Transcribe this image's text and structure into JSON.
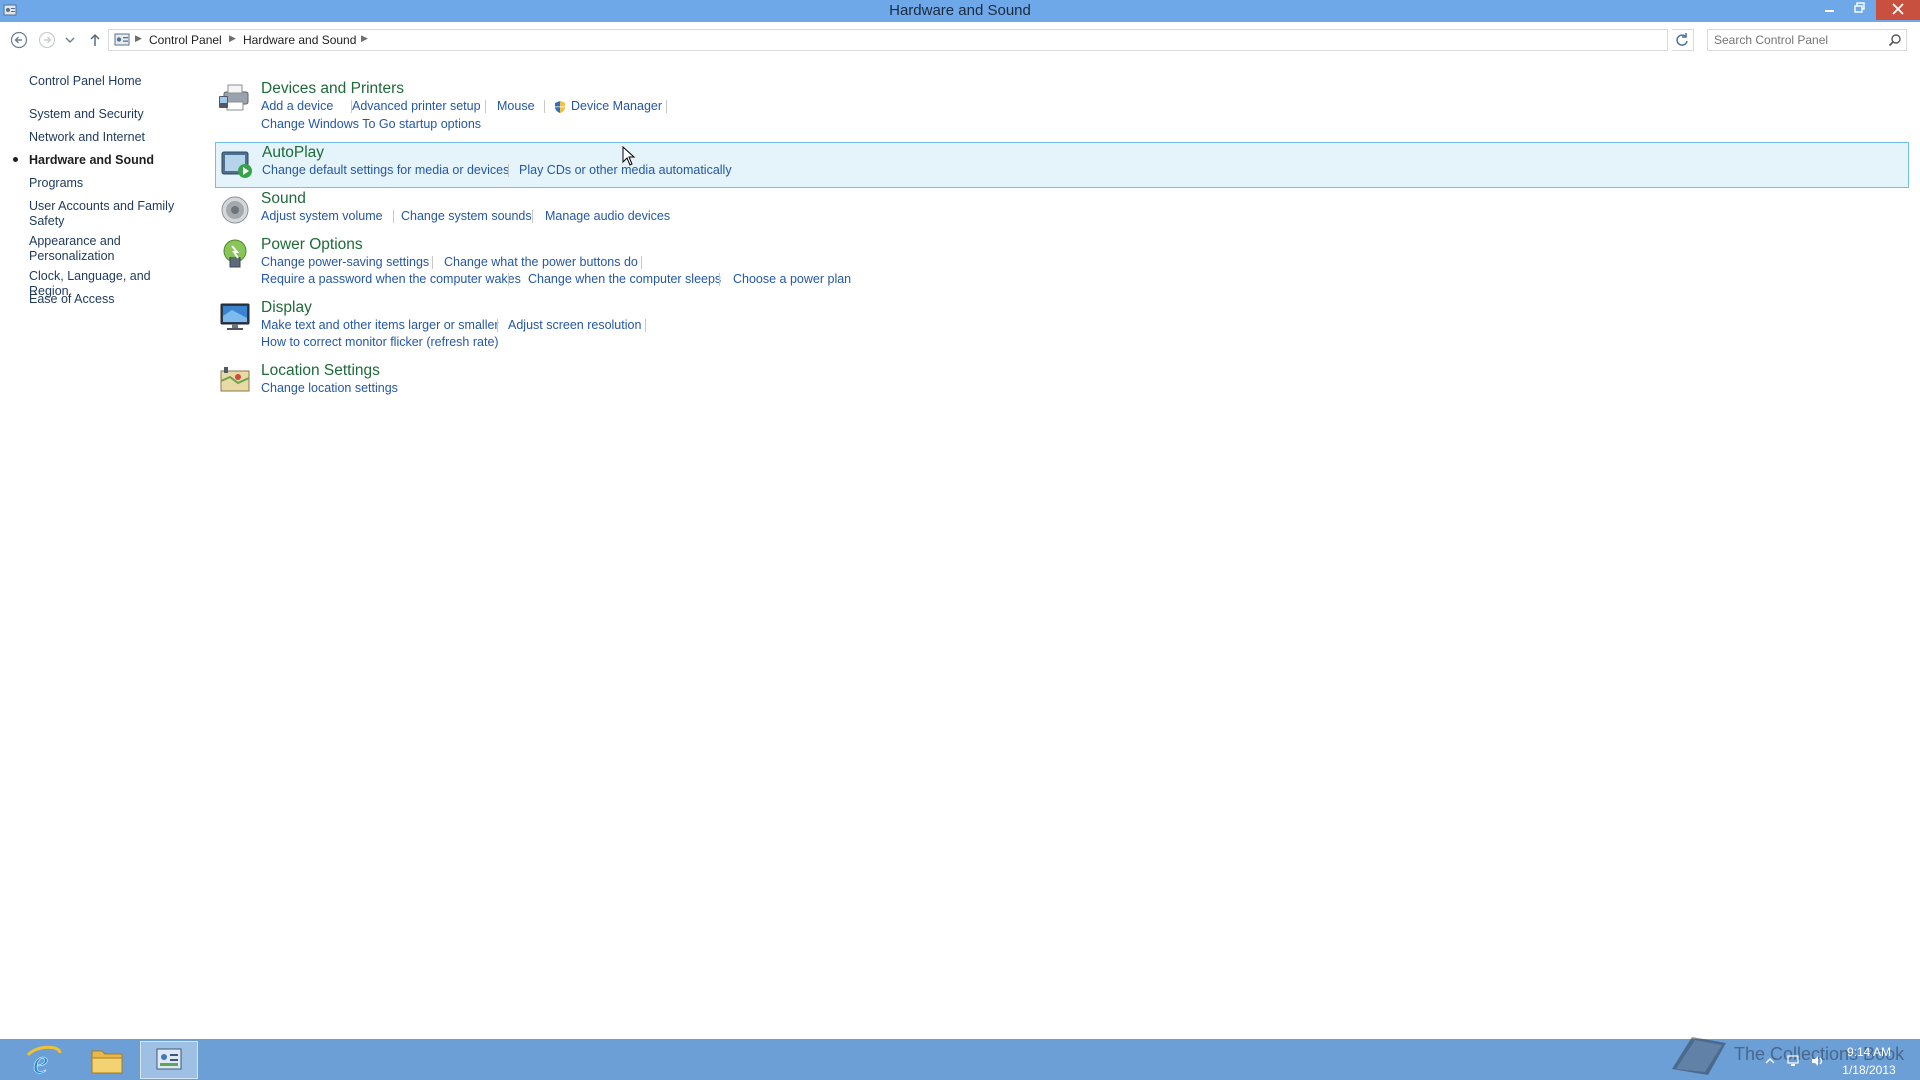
{
  "window": {
    "title": "Hardware and Sound",
    "minimize_icon": "minimize-icon",
    "maximize_icon": "restore-icon",
    "close_icon": "close-icon"
  },
  "address_bar": {
    "crumbs": [
      "Control Panel",
      "Hardware and Sound"
    ],
    "search_placeholder": "Search Control Panel"
  },
  "sidebar": {
    "home": "Control Panel Home",
    "items": [
      {
        "label": "System and Security"
      },
      {
        "label": "Network and Internet"
      },
      {
        "label": "Hardware and Sound",
        "current": true
      },
      {
        "label": "Programs"
      },
      {
        "label": "User Accounts and Family Safety"
      },
      {
        "label": "Appearance and Personalization"
      },
      {
        "label": "Clock, Language, and Region"
      },
      {
        "label": "Ease of Access"
      }
    ]
  },
  "categories": [
    {
      "title": "Devices and Printers",
      "icon": "printer-icon",
      "links": [
        "Add a device",
        "Advanced printer setup",
        "Mouse",
        "Device Manager",
        "Change Windows To Go startup options"
      ]
    },
    {
      "title": "AutoPlay",
      "icon": "autoplay-icon",
      "links": [
        "Change default settings for media or devices",
        "Play CDs or other media automatically"
      ]
    },
    {
      "title": "Sound",
      "icon": "speaker-icon",
      "links": [
        "Adjust system volume",
        "Change system sounds",
        "Manage audio devices"
      ]
    },
    {
      "title": "Power Options",
      "icon": "power-icon",
      "links": [
        "Change power-saving settings",
        "Change what the power buttons do",
        "Require a password when the computer wakes",
        "Change when the computer sleeps",
        "Choose a power plan"
      ]
    },
    {
      "title": "Display",
      "icon": "monitor-icon",
      "links": [
        "Make text and other items larger or smaller",
        "Adjust screen resolution",
        "How to correct monitor flicker (refresh rate)"
      ]
    },
    {
      "title": "Location Settings",
      "icon": "location-icon",
      "links": [
        "Change location settings"
      ]
    }
  ],
  "taskbar": {
    "apps": [
      "internet-explorer-icon",
      "file-explorer-icon",
      "control-panel-icon"
    ],
    "watermark": "The Collections Book",
    "clock_time": "9:14 AM",
    "clock_date": "1/18/2013"
  },
  "colors": {
    "titlebar": "#6fa8e8",
    "taskbar": "#6b9fd6",
    "category_title": "#1e6a39",
    "link": "#2457a6",
    "hover_bg": "#e5f3fb",
    "hover_border": "#70c0e7",
    "close_button": "#c7503f"
  }
}
